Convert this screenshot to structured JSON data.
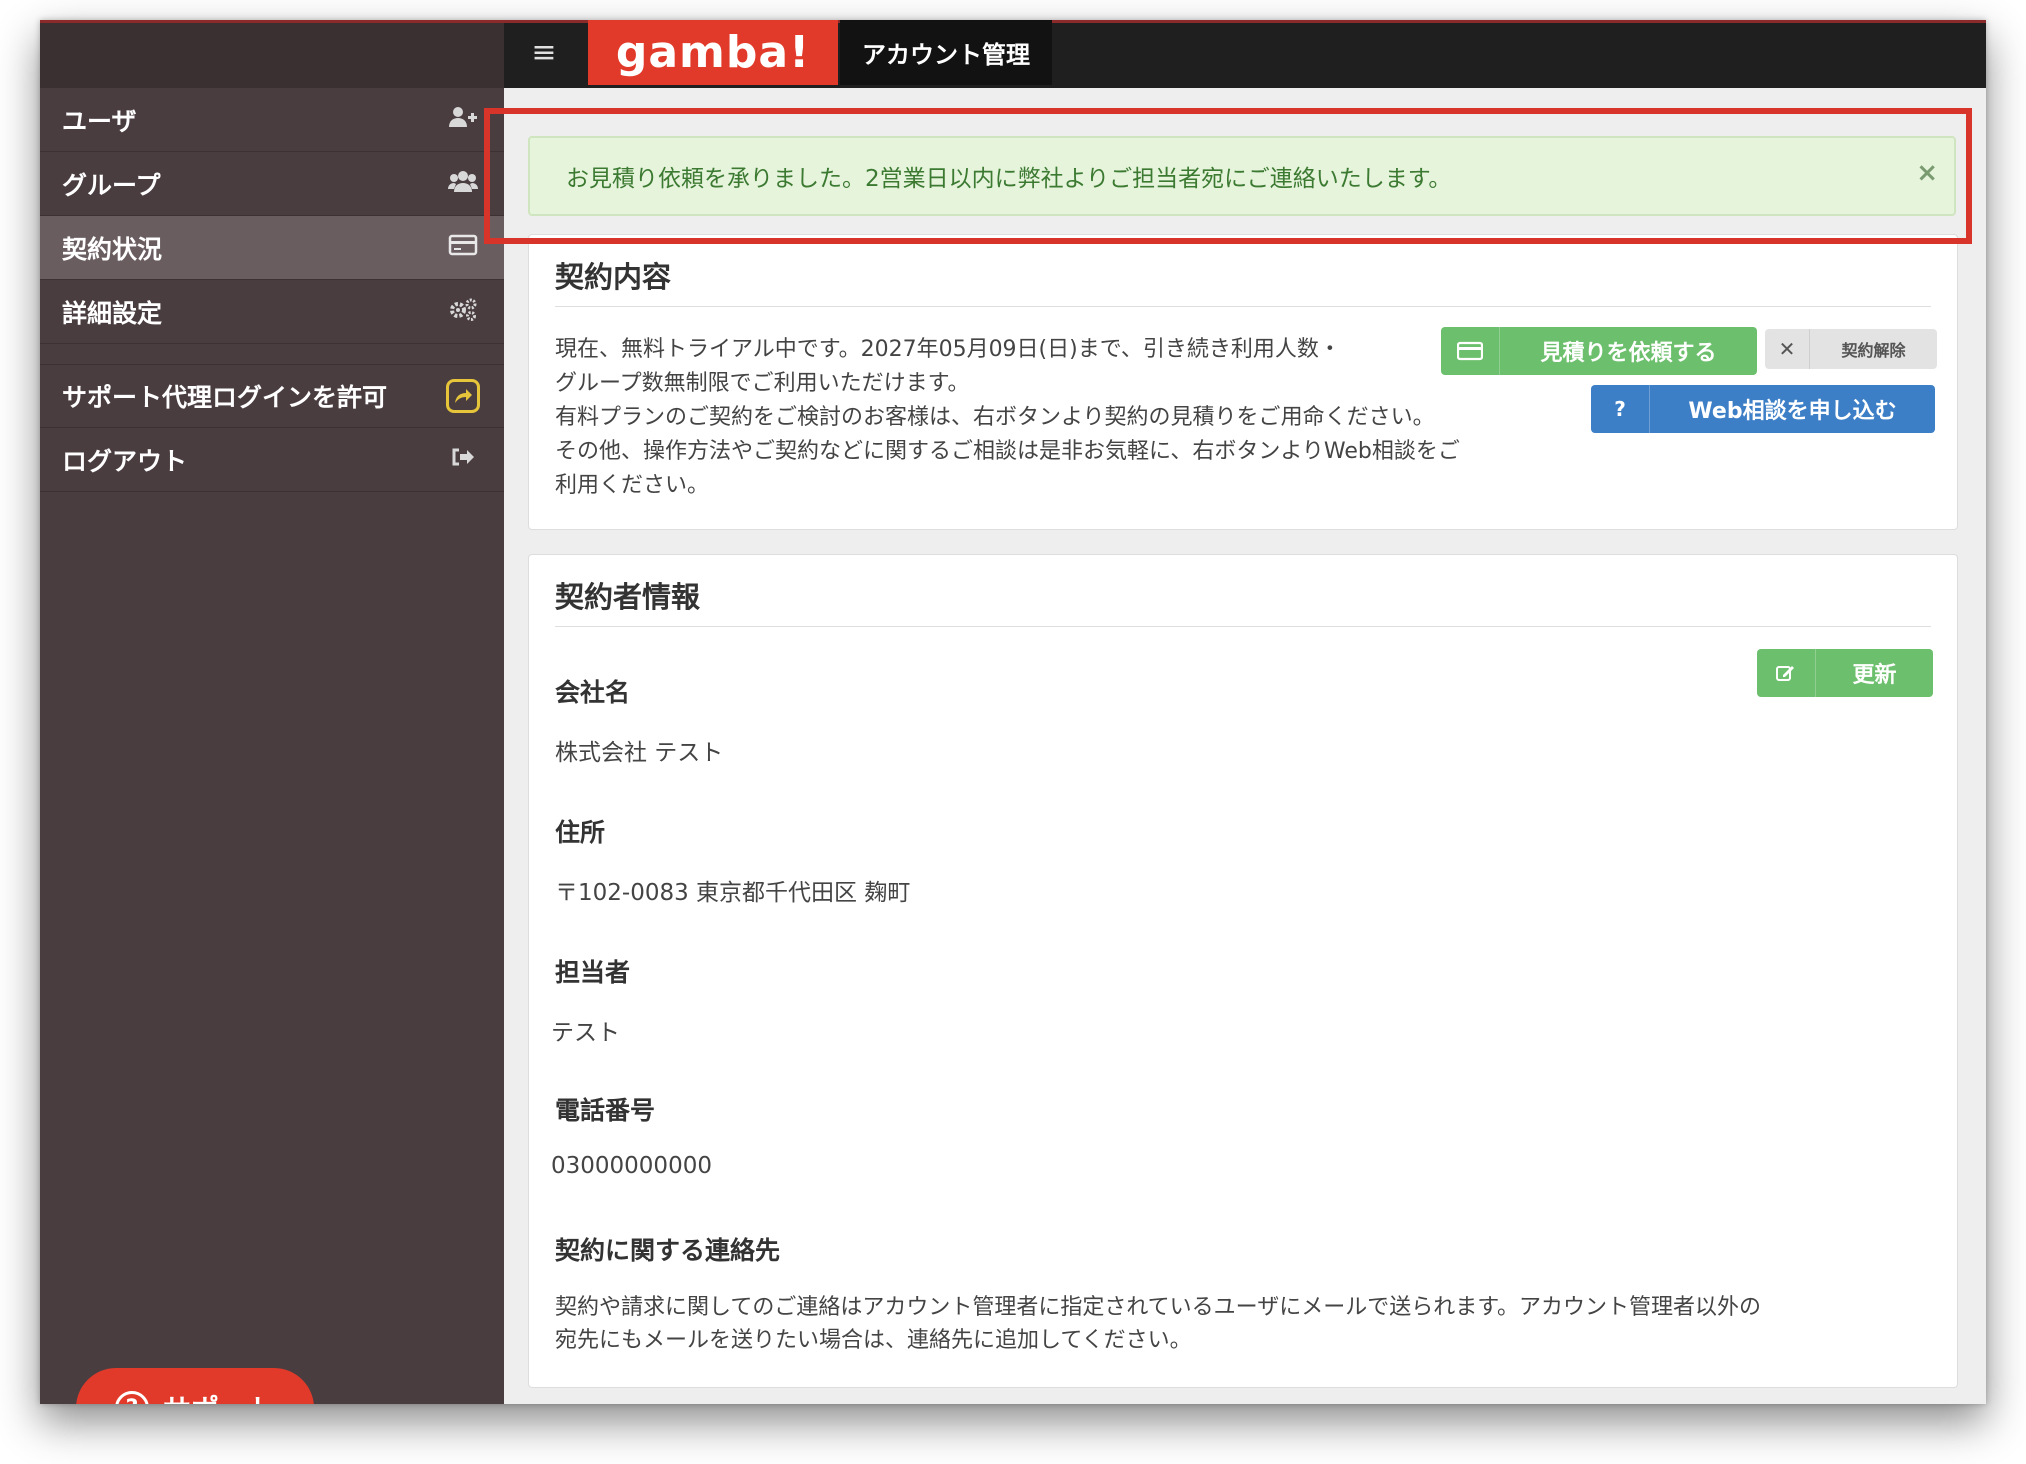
{
  "header": {
    "logo": "gamba!",
    "title": "アカウント管理"
  },
  "sidebar": {
    "items": [
      {
        "label": "ユーザ",
        "icon": "add-user-icon"
      },
      {
        "label": "グループ",
        "icon": "group-icon"
      },
      {
        "label": "契約状況",
        "icon": "credit-card-icon",
        "active": true
      },
      {
        "label": "詳細設定",
        "icon": "gears-icon"
      },
      {
        "label": "サポート代理ログインを許可",
        "icon": "share-icon"
      },
      {
        "label": "ログアウト",
        "icon": "sign-out-icon"
      }
    ],
    "support_button": "サポート"
  },
  "alert": {
    "message": "お見積り依頼を承りました。2営業日以内に弊社よりご担当者宛にご連絡いたします。",
    "close": "×"
  },
  "contract_panel": {
    "title": "契約内容",
    "lines": [
      "現在、無料トライアル中です。2027年05月09日(日)まで、引き続き利用人数・",
      "グループ数無制限でご利用いただけます。",
      "有料プランのご契約をご検討のお客様は、右ボタンより契約の見積りをご用命ください。",
      "その他、操作方法やご契約などに関するご相談は是非お気軽に、右ボタンよりWeb相談をご",
      "利用ください。"
    ],
    "quote_button": "見積りを依頼する",
    "cancel_button": "契約解除",
    "web_consult_button": "Web相談を申し込む"
  },
  "contractor_panel": {
    "title": "契約者情報",
    "update_button": "更新",
    "fields": [
      {
        "label": "会社名",
        "value": "株式会社 テスト"
      },
      {
        "label": "住所",
        "value": "〒102-0083 東京都千代田区 麹町"
      },
      {
        "label": "担当者",
        "value": "テスト"
      },
      {
        "label": "電話番号",
        "value": "03000000000"
      }
    ],
    "contact_title": "契約に関する連絡先",
    "contact_lines": [
      "契約や請求に関してのご連絡はアカウント管理者に指定されているユーザにメールで送られます。アカウント管理者以外の",
      "宛先にもメールを送りたい場合は、連絡先に追加してください。"
    ]
  },
  "colors": {
    "brand": "#e13a2a",
    "sidebar": "#4a3d40",
    "alert_bg": "#e6f4dc",
    "alert_text": "#3c7a32",
    "highlight_frame": "#d9342a",
    "button_green": "#6cbf6c",
    "button_blue": "#3d7fc7"
  }
}
